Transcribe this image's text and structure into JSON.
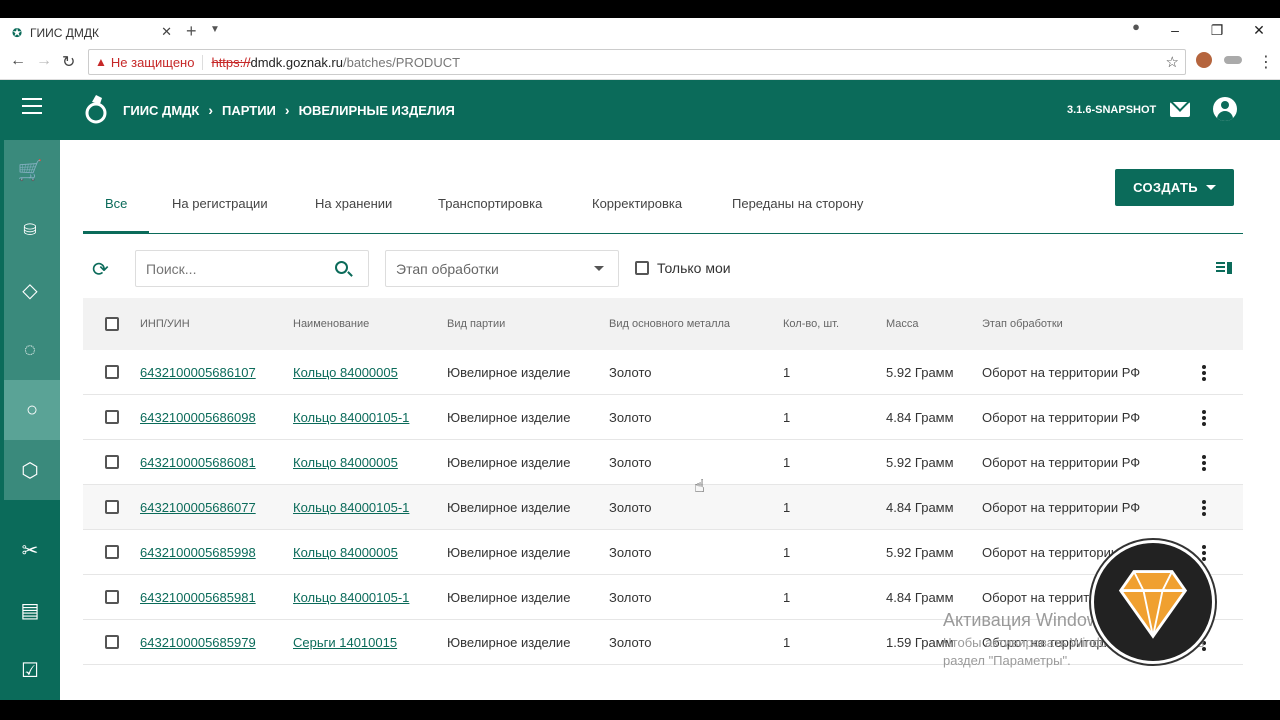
{
  "browser": {
    "tab_title": "ГИИС ДМДК",
    "insecure_label": "Не защищено",
    "url_scheme": "https://",
    "url_host": "dmdk.goznak.ru",
    "url_path": "/batches/PRODUCT"
  },
  "appbar": {
    "crumb_1": "ГИИС ДМДК",
    "crumb_2": "ПАРТИИ",
    "crumb_3": "ЮВЕЛИРНЫЕ ИЗДЕЛИЯ",
    "version": "3.1.6-SNAPSHOT"
  },
  "tabs": [
    {
      "label": "Все"
    },
    {
      "label": "На регистрации"
    },
    {
      "label": "На хранении"
    },
    {
      "label": "Транспортировка"
    },
    {
      "label": "Корректировка"
    },
    {
      "label": "Переданы на сторону"
    }
  ],
  "create_button": "СОЗДАТЬ",
  "filters": {
    "search_placeholder": "Поиск...",
    "stage_placeholder": "Этап обработки",
    "only_mine": "Только мои"
  },
  "table": {
    "columns": [
      "ИНП/УИН",
      "Наименование",
      "Вид партии",
      "Вид основного металла",
      "Кол-во, шт.",
      "Масса",
      "Этап обработки"
    ],
    "rows": [
      {
        "id": "6432100005686107",
        "name": "Кольцо 84000005",
        "kind": "Ювелирное изделие",
        "metal": "Золото",
        "qty": "1",
        "mass": "5.92 Грамм",
        "stage": "Оборот на территории РФ"
      },
      {
        "id": "6432100005686098",
        "name": "Кольцо 84000105-1",
        "kind": "Ювелирное изделие",
        "metal": "Золото",
        "qty": "1",
        "mass": "4.84 Грамм",
        "stage": "Оборот на территории РФ"
      },
      {
        "id": "6432100005686081",
        "name": "Кольцо 84000005",
        "kind": "Ювелирное изделие",
        "metal": "Золото",
        "qty": "1",
        "mass": "5.92 Грамм",
        "stage": "Оборот на территории РФ"
      },
      {
        "id": "6432100005686077",
        "name": "Кольцо 84000105-1",
        "kind": "Ювелирное изделие",
        "metal": "Золото",
        "qty": "1",
        "mass": "4.84 Грамм",
        "stage": "Оборот на территории РФ"
      },
      {
        "id": "6432100005685998",
        "name": "Кольцо 84000005",
        "kind": "Ювелирное изделие",
        "metal": "Золото",
        "qty": "1",
        "mass": "5.92 Грамм",
        "stage": "Оборот на территории РФ"
      },
      {
        "id": "6432100005685981",
        "name": "Кольцо 84000105-1",
        "kind": "Ювелирное изделие",
        "metal": "Золото",
        "qty": "1",
        "mass": "4.84 Грамм",
        "stage": "Оборот на территории РФ"
      },
      {
        "id": "6432100005685979",
        "name": "Серьги 14010015",
        "kind": "Ювелирное изделие",
        "metal": "Золото",
        "qty": "1",
        "mass": "1.59 Грамм",
        "stage": "Оборот на территории РФ"
      }
    ]
  },
  "watermark": {
    "line1": "Активация Windows",
    "line2": "Чтобы активировать Windows, перейдите в раздел \"Параметры\"."
  },
  "colors": {
    "brand": "#0b6b5a",
    "rail_active": "#5aa396"
  }
}
